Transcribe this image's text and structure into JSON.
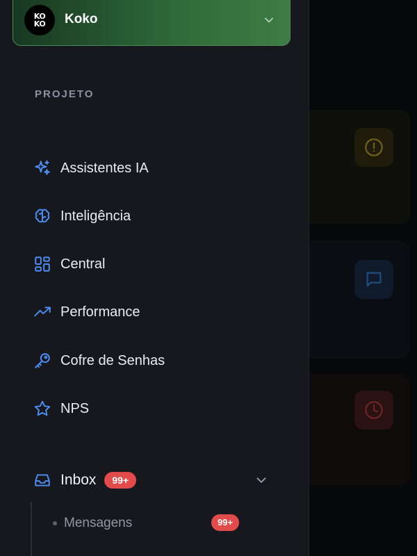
{
  "project": {
    "name": "Koko",
    "avatar_text": "KO KO"
  },
  "section_label": "PROJETO",
  "nav": [
    {
      "label": "Assistentes IA",
      "icon": "sparkles-icon"
    },
    {
      "label": "Inteligência",
      "icon": "brain-icon"
    },
    {
      "label": "Central",
      "icon": "dashboard-grid-icon"
    },
    {
      "label": "Performance",
      "icon": "trending-up-icon"
    },
    {
      "label": "Cofre de Senhas",
      "icon": "key-icon"
    },
    {
      "label": "NPS",
      "icon": "star-icon"
    }
  ],
  "inbox": {
    "label": "Inbox",
    "badge": "99+",
    "sub_items": [
      {
        "label": "Mensagens",
        "badge": "99+"
      }
    ]
  },
  "colors": {
    "accent": "#4d8ef7",
    "badge": "#e24b4b",
    "sidebar_bg": "#16181d"
  }
}
